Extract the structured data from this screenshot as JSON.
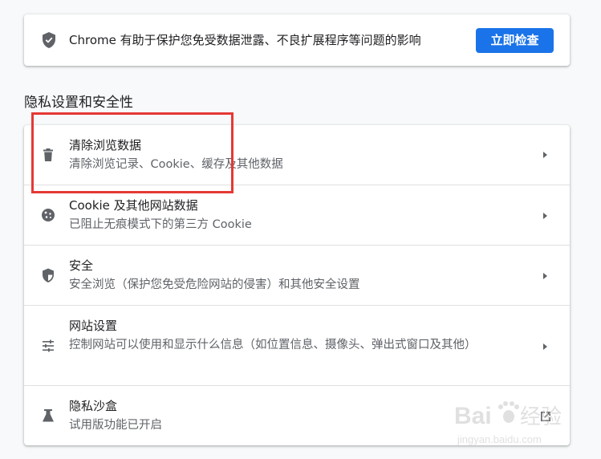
{
  "safety_check": {
    "text": "Chrome 有助于保护您免受数据泄露、不良扩展程序等问题的影响",
    "button_label": "立即检查"
  },
  "section_title": "隐私设置和安全性",
  "rows": [
    {
      "title": "清除浏览数据",
      "description": "清除浏览记录、Cookie、缓存及其他数据",
      "icon": "trash-icon"
    },
    {
      "title": "Cookie 及其他网站数据",
      "description": "已阻止无痕模式下的第三方 Cookie",
      "icon": "cookie-icon"
    },
    {
      "title": "安全",
      "description": "安全浏览（保护您免受危险网站的侵害）和其他安全设置",
      "icon": "shield-icon"
    },
    {
      "title": "网站设置",
      "description": "控制网站可以使用和显示什么信息（如位置信息、摄像头、弹出式窗口及其他）",
      "icon": "tune-icon"
    },
    {
      "title": "隐私沙盒",
      "description": "试用版功能已开启",
      "icon": "flask-icon"
    }
  ],
  "watermark": {
    "text": "Baidu经验",
    "subtext": "jingyan.baidu.com"
  },
  "colors": {
    "accent": "#1a73e8",
    "highlight": "#e53935",
    "icon": "#5f6368"
  }
}
